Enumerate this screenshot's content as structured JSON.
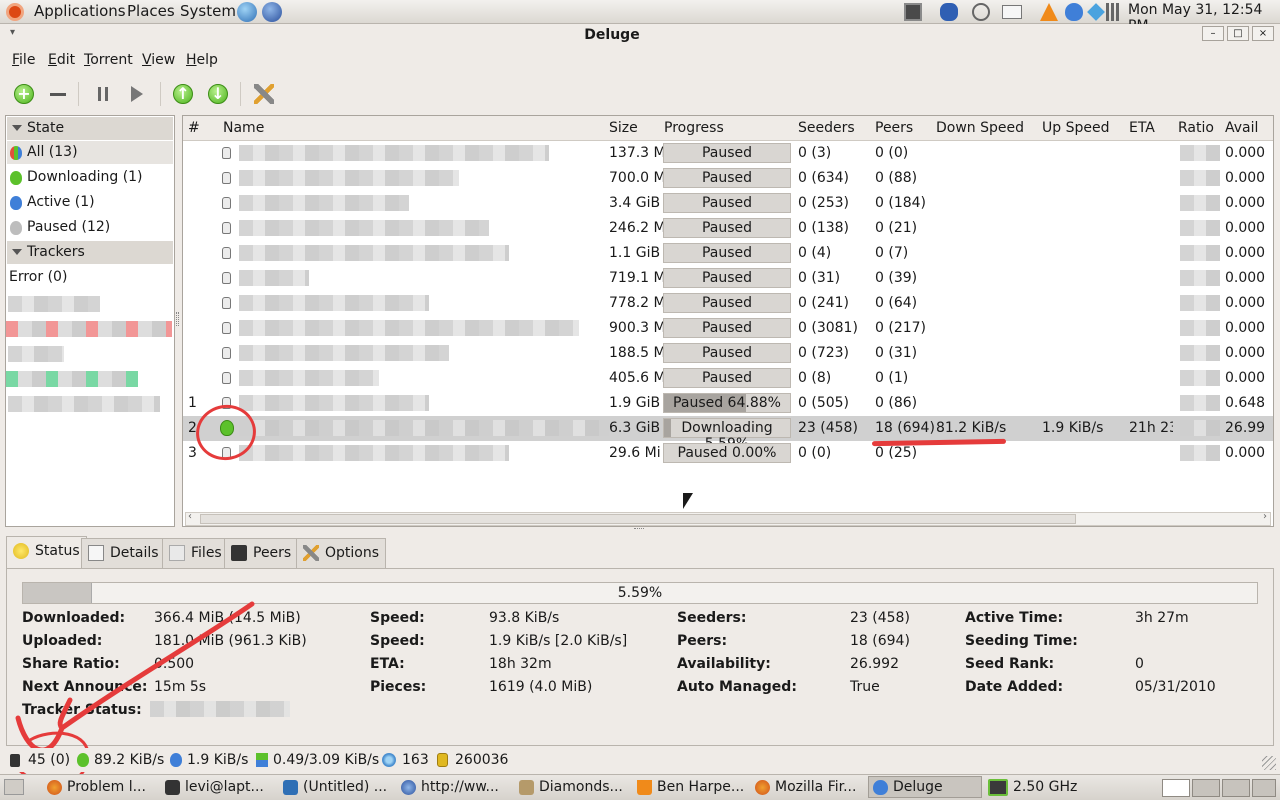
{
  "top_panel": {
    "menus": [
      "Applications",
      "Places",
      "System"
    ],
    "clock": "Mon May 31, 12:54 PM"
  },
  "window": {
    "title": "Deluge",
    "controls": {
      "minimize": "–",
      "maximize": "□",
      "close": "×"
    }
  },
  "menubar": [
    "File",
    "Edit",
    "Torrent",
    "View",
    "Help"
  ],
  "sidebar": {
    "state_header": "State",
    "states": [
      {
        "label": "All (13)",
        "color": "#6ab04c"
      },
      {
        "label": "Downloading (1)",
        "color": "#5cc12b"
      },
      {
        "label": "Active (1)",
        "color": "#3f7fd8"
      },
      {
        "label": "Paused (12)",
        "color": "#bdbdbd"
      }
    ],
    "trackers_header": "Trackers",
    "trackers": [
      "Error (0)"
    ]
  },
  "columns": [
    "#",
    "Name",
    "Size",
    "Progress",
    "Seeders",
    "Peers",
    "Down Speed",
    "Up Speed",
    "ETA",
    "Ratio",
    "Avail"
  ],
  "torrents": [
    {
      "num": "",
      "size": "137.3 M",
      "progress": "Paused",
      "pct": 0,
      "seeders": "0 (3)",
      "peers": "0 (0)",
      "down": "",
      "up": "",
      "eta": "",
      "avail": "0.000"
    },
    {
      "num": "",
      "size": "700.0 M",
      "progress": "Paused",
      "pct": 0,
      "seeders": "0 (634)",
      "peers": "0 (88)",
      "down": "",
      "up": "",
      "eta": "",
      "avail": "0.000"
    },
    {
      "num": "",
      "size": "3.4 GiB",
      "progress": "Paused",
      "pct": 0,
      "seeders": "0 (253)",
      "peers": "0 (184)",
      "down": "",
      "up": "",
      "eta": "",
      "avail": "0.000"
    },
    {
      "num": "",
      "size": "246.2 M",
      "progress": "Paused",
      "pct": 0,
      "seeders": "0 (138)",
      "peers": "0 (21)",
      "down": "",
      "up": "",
      "eta": "",
      "avail": "0.000"
    },
    {
      "num": "",
      "size": "1.1 GiB",
      "progress": "Paused",
      "pct": 0,
      "seeders": "0 (4)",
      "peers": "0 (7)",
      "down": "",
      "up": "",
      "eta": "",
      "avail": "0.000"
    },
    {
      "num": "",
      "size": "719.1 M",
      "progress": "Paused",
      "pct": 0,
      "seeders": "0 (31)",
      "peers": "0 (39)",
      "down": "",
      "up": "",
      "eta": "",
      "avail": "0.000"
    },
    {
      "num": "",
      "size": "778.2 M",
      "progress": "Paused",
      "pct": 0,
      "seeders": "0 (241)",
      "peers": "0 (64)",
      "down": "",
      "up": "",
      "eta": "",
      "avail": "0.000"
    },
    {
      "num": "",
      "size": "900.3 M",
      "progress": "Paused",
      "pct": 0,
      "seeders": "0 (3081)",
      "peers": "0 (217)",
      "down": "",
      "up": "",
      "eta": "",
      "avail": "0.000"
    },
    {
      "num": "",
      "size": "188.5 M",
      "progress": "Paused",
      "pct": 0,
      "seeders": "0 (723)",
      "peers": "0 (31)",
      "down": "",
      "up": "",
      "eta": "",
      "avail": "0.000"
    },
    {
      "num": "",
      "size": "405.6 M",
      "progress": "Paused",
      "pct": 0,
      "seeders": "0 (8)",
      "peers": "0 (1)",
      "down": "",
      "up": "",
      "eta": "",
      "avail": "0.000"
    },
    {
      "num": "1",
      "size": "1.9 GiB",
      "progress": "Paused 64.88%",
      "pct": 64.88,
      "seeders": "0 (505)",
      "peers": "0 (86)",
      "down": "",
      "up": "",
      "eta": "",
      "avail": "0.648"
    },
    {
      "num": "2",
      "size": "6.3 GiB",
      "progress": "Downloading 5.59%",
      "pct": 5.59,
      "seeders": "23 (458)",
      "peers": "18 (694)",
      "down": "81.2 KiB/s",
      "up": "1.9 KiB/s",
      "eta": "21h 23",
      "avail": "26.99",
      "selected": true,
      "downloading": true
    },
    {
      "num": "3",
      "size": "29.6 Mi",
      "progress": "Paused 0.00%",
      "pct": 0,
      "seeders": "0 (0)",
      "peers": "0 (25)",
      "down": "",
      "up": "",
      "eta": "",
      "avail": "0.000"
    }
  ],
  "tabs": [
    "Status",
    "Details",
    "Files",
    "Peers",
    "Options"
  ],
  "status": {
    "progress_text": "5.59%",
    "progress_pct": 5.59,
    "col1": [
      {
        "label": "Downloaded:",
        "value": "366.4 MiB (14.5 MiB)"
      },
      {
        "label": "Uploaded:",
        "value": "181.0 MiB (961.3 KiB)"
      },
      {
        "label": "Share Ratio:",
        "value": "0.500"
      },
      {
        "label": "Next Announce:",
        "value": "15m 5s"
      },
      {
        "label": "Tracker Status:",
        "value": ""
      }
    ],
    "col2": [
      {
        "label": "Speed:",
        "value": "93.8 KiB/s"
      },
      {
        "label": "Speed:",
        "value": "1.9 KiB/s [2.0 KiB/s]"
      },
      {
        "label": "ETA:",
        "value": "18h 32m"
      },
      {
        "label": "Pieces:",
        "value": "1619 (4.0 MiB)"
      }
    ],
    "col3": [
      {
        "label": "Seeders:",
        "value": "23 (458)"
      },
      {
        "label": "Peers:",
        "value": "18 (694)"
      },
      {
        "label": "Availability:",
        "value": "26.992"
      },
      {
        "label": "Auto Managed:",
        "value": "True"
      }
    ],
    "col4": [
      {
        "label": "Active Time:",
        "value": "3h 27m"
      },
      {
        "label": "Seeding Time:",
        "value": ""
      },
      {
        "label": "Seed Rank:",
        "value": "0"
      },
      {
        "label": "Date Added:",
        "value": "05/31/2010"
      }
    ]
  },
  "statusbar": {
    "connections": "45 (0)",
    "down_speed": "89.2 KiB/s",
    "up_speed": "1.9 KiB/s",
    "protocol": "0.49/3.09 KiB/s",
    "dht": "163",
    "free_space": "260036"
  },
  "taskbar": {
    "tasks": [
      "Problem l...",
      "levi@lapt...",
      "(Untitled) ...",
      "http://ww...",
      "Diamonds...",
      "Ben Harpe...",
      "Mozilla Fir...",
      "Deluge"
    ],
    "cpu": "2.50 GHz"
  }
}
